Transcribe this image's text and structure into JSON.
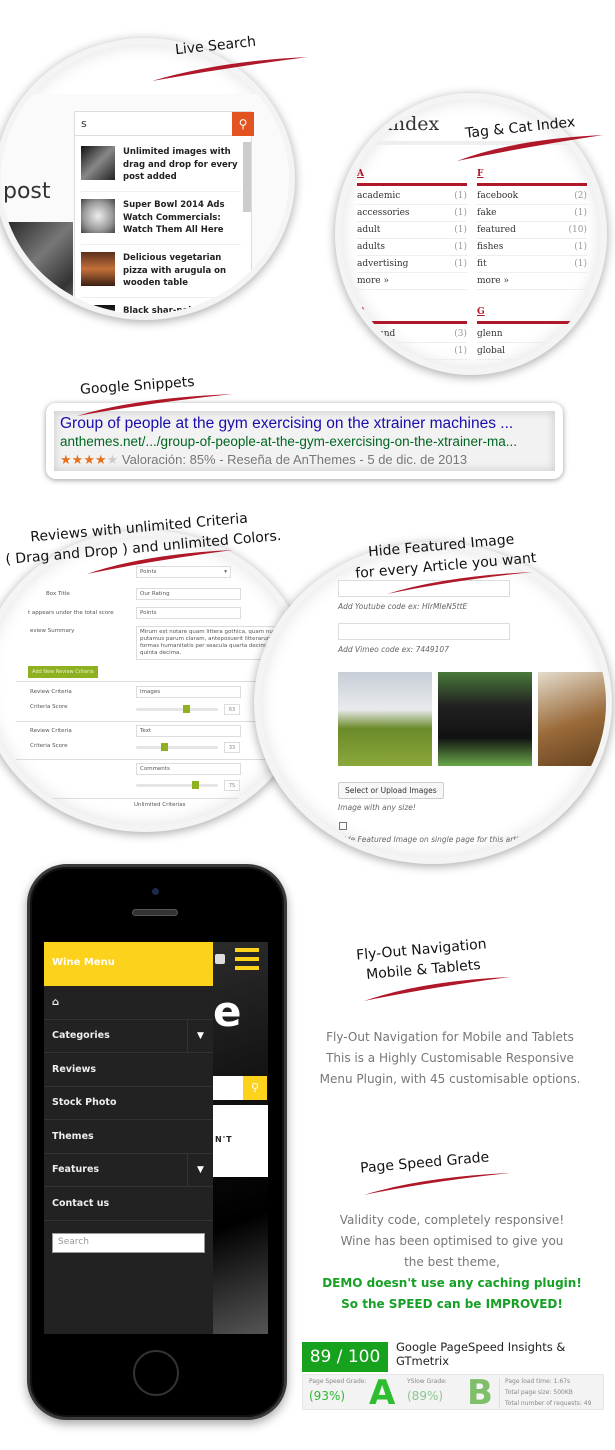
{
  "live_search": {
    "label": "Live Search",
    "query": "s",
    "background_word": "post",
    "results": [
      {
        "title": "Unlimited images with drag and drop for every post added"
      },
      {
        "title": "Super Bowl 2014 Ads Watch Commercials: Watch Them All Here"
      },
      {
        "title": "Delicious vegetarian pizza with arugula on wooden table"
      },
      {
        "title": "Black shar-pei dog with glasses is reading a book"
      }
    ]
  },
  "tag_index": {
    "label": "Tag & Cat Index",
    "page_title": "s index",
    "more_label": "more »",
    "groups": [
      {
        "letter": "A",
        "items": [
          {
            "name": "academic",
            "count": "(1)"
          },
          {
            "name": "accessories",
            "count": "(1)"
          },
          {
            "name": "adult",
            "count": "(1)"
          },
          {
            "name": "adults",
            "count": "(1)"
          },
          {
            "name": "advertising",
            "count": "(1)"
          }
        ]
      },
      {
        "letter": "F",
        "items": [
          {
            "name": "facebook",
            "count": "(2)"
          },
          {
            "name": "fake",
            "count": "(1)"
          },
          {
            "name": "featured",
            "count": "(10)"
          },
          {
            "name": "fishes",
            "count": "(1)"
          },
          {
            "name": "fit",
            "count": "(1)"
          }
        ]
      },
      {
        "letter": "B",
        "items": [
          {
            "name": "kground",
            "count": "(3)"
          },
          {
            "name": "",
            "count": "(1)"
          }
        ]
      },
      {
        "letter": "G",
        "items": [
          {
            "name": "glenn",
            "count": ""
          },
          {
            "name": "global",
            "count": ""
          }
        ]
      }
    ]
  },
  "google_snippet": {
    "label": "Google Snippets",
    "title": "Group of people at the gym exercising on the xtrainer machines ...",
    "url": "anthemes.net/.../group-of-people-at-the-gym-exercising-on-the-xtrainer-ma...",
    "rating_stars": 4,
    "rating_max": 5,
    "meta": "Valoración: 85% - Reseña de AnThemes - 5 de dic. de 2013",
    "colors": {
      "title": "#1a0dab",
      "url": "#006621",
      "star": "#e7711b"
    }
  },
  "reviews": {
    "label_line1": "Reviews with unlimited Criteria",
    "label_line2": "( Drag and Drop ) and unlimited Colors.",
    "select_value": "Points",
    "box_title_label": "Box Title",
    "box_title_value": "Our Rating",
    "under_score_label": "t appears under the total score",
    "under_score_value": "Points",
    "summary_label": "eview Summary",
    "summary_value": "Mirum est notare quam littera gothica, quam nunc putamus parum claram, anteposuerit litterarum formas humanitatis per seacula quarta decima et quinta decima.",
    "add_button": "Add New Review Criteria",
    "criteria_label": "Review Criteria",
    "score_label": "Criteria Score",
    "criteria": [
      {
        "name": "Images",
        "score": 63
      },
      {
        "name": "Text",
        "score": 33
      },
      {
        "name": "Comments",
        "score": 75
      }
    ],
    "footer": "Unlimited Criterias",
    "accent": "#8fb020"
  },
  "hide_featured": {
    "label_line1": "Hide Featured Image",
    "label_line2": "for every Article you want",
    "youtube_note": "Add Youtube code ex: HIrMIeN5ttE",
    "vimeo_note": "Add Vimeo code ex: 7449107",
    "images": [
      "airplane",
      "racehorse",
      "dog"
    ],
    "upload_button": "Select or Upload Images",
    "size_note": "Image with any size!",
    "checkbox_label": "Hide Featured Image on single page for this article",
    "checked": false
  },
  "phone_menu": {
    "menu_title": "Wine Menu",
    "items": [
      {
        "label": "",
        "icon": "home-icon",
        "submenu": false
      },
      {
        "label": "Categories",
        "submenu": true
      },
      {
        "label": "Reviews",
        "submenu": false
      },
      {
        "label": "Stock Photo",
        "submenu": false
      },
      {
        "label": "Themes",
        "submenu": false
      },
      {
        "label": "Features",
        "submenu": true
      },
      {
        "label": "Contact us",
        "submenu": false
      }
    ],
    "search_placeholder": "Search",
    "bg_letter": "e",
    "bg_text": "N'T",
    "accent": "#fcd21c"
  },
  "flyout": {
    "label_line1": "Fly-Out Navigation",
    "label_line2": "Mobile & Tablets",
    "description": "Fly-Out Navigation for Mobile and Tablets This is a Highly Customisable Responsive Menu Plugin, with 45 customisable options."
  },
  "page_speed": {
    "label": "Page Speed Grade",
    "line1": "Validity code, completely responsive!",
    "line2": "Wine has been optimised to give you",
    "line3": "the best theme,",
    "green1": "DEMO doesn't use any caching plugin!",
    "green2": "So the SPEED can be IMPROVED!",
    "score": "89 / 100",
    "score_title": "Google PageSpeed Insights & GTmetrix",
    "gtmetrix": {
      "pagespeed_label": "Page Speed Grade:",
      "pagespeed_pct": "(93%)",
      "pagespeed_grade": "A",
      "yslow_label": "YSlow Grade:",
      "yslow_pct": "(89%)",
      "yslow_grade": "B",
      "load_time": "Page load time: 1.67s",
      "page_size": "Total page size: 500KB",
      "requests": "Total number of requests: 49"
    },
    "green": "#17a21d"
  }
}
